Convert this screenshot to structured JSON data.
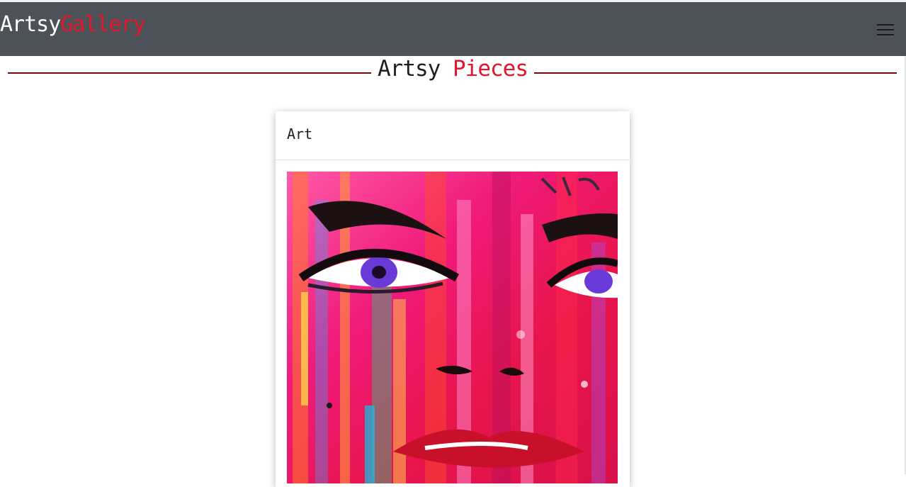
{
  "navbar": {
    "brand_part1": "Artsy",
    "brand_part2": "Gallery",
    "menu_icon": "hamburger-menu-icon"
  },
  "section": {
    "title_part1": "Artsy",
    "title_part2": "Pieces"
  },
  "card": {
    "title": "Art",
    "image_subject": "colorful painted face artwork"
  },
  "colors": {
    "navbar_bg": "#4d5158",
    "accent_red": "#e3172b",
    "rule": "#6e0c0c"
  }
}
